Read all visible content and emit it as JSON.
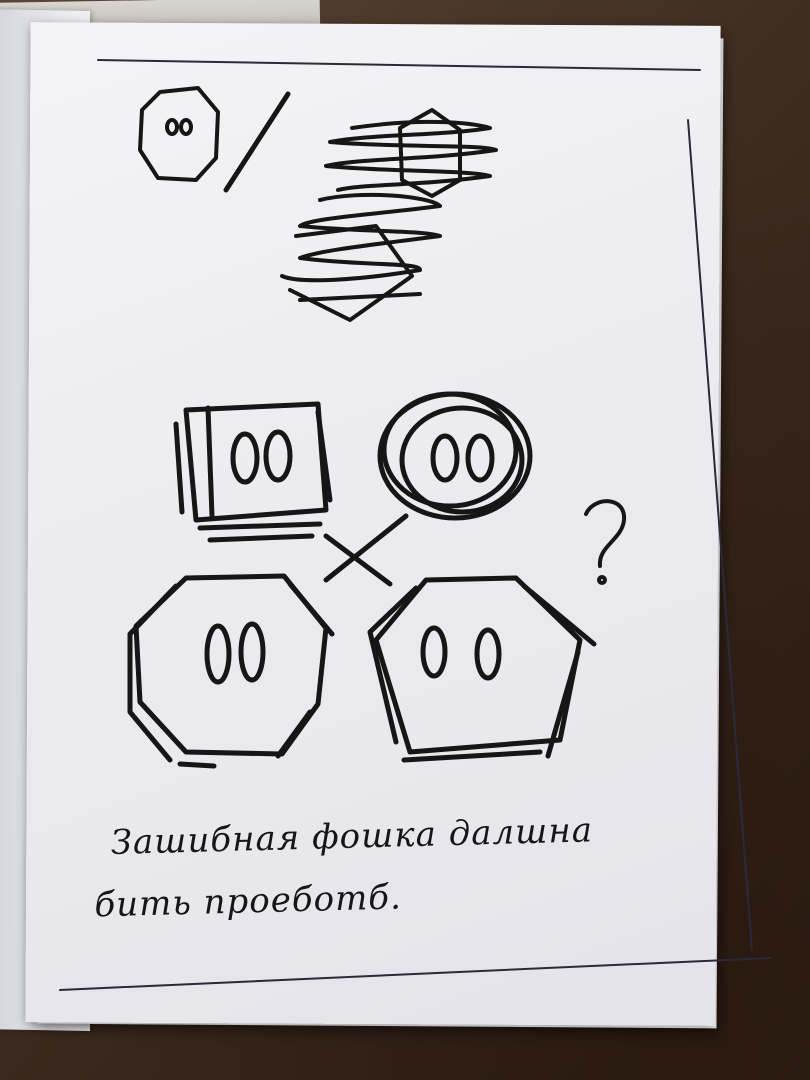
{
  "note": {
    "line1": "Зашибная фошка далшна",
    "line2": "бить проеботб."
  },
  "sketch": {
    "question_mark": "?"
  },
  "colors": {
    "ink": "#161616",
    "paper": "#efeff2",
    "table": "#3e2c20"
  }
}
